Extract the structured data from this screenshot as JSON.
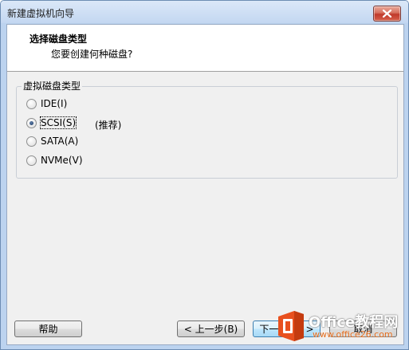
{
  "window": {
    "title": "新建虚拟机向导"
  },
  "header": {
    "title": "选择磁盘类型",
    "subtitle": "您要创建何种磁盘?"
  },
  "group": {
    "label": "虚拟磁盘类型",
    "options": [
      {
        "label": "IDE(I)",
        "checked": false
      },
      {
        "label": "SCSI(S)",
        "checked": true
      },
      {
        "label": "SATA(A)",
        "checked": false
      },
      {
        "label": "NVMe(V)",
        "checked": false
      }
    ],
    "recommend": "(推荐)"
  },
  "buttons": {
    "help": "帮助",
    "back": "< 上一步(B)",
    "next": "下一步(N) >",
    "cancel": "取消"
  },
  "watermark": {
    "text": "Office教程网",
    "url": "www.office26.com"
  },
  "colors": {
    "watermark_orange": "#e8501e",
    "close_red": "#c0392b"
  }
}
